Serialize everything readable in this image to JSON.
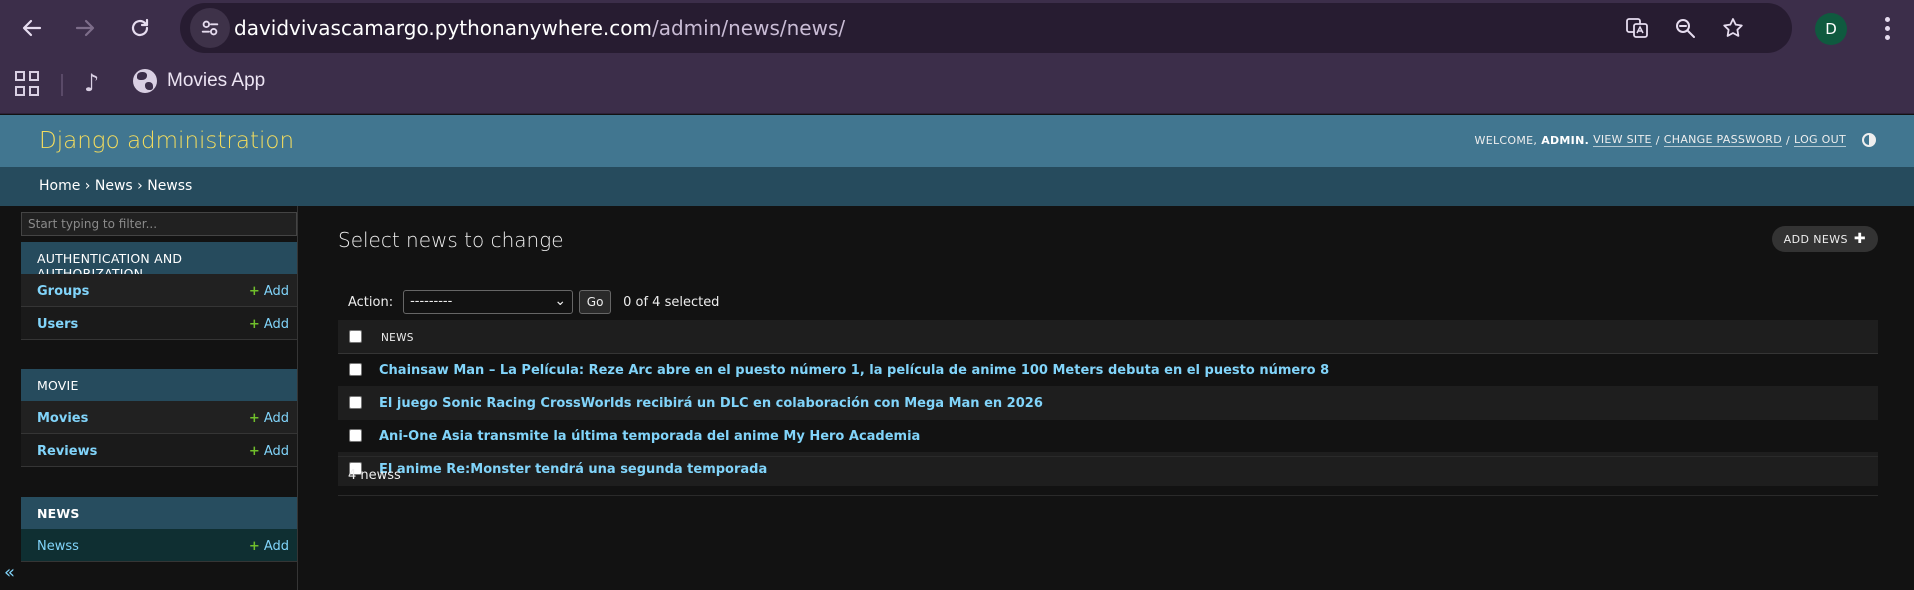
{
  "browser": {
    "url_host": "davidvivascamargo.pythonanywhere.com",
    "url_path": "/admin/news/news/",
    "profile_initial": "D",
    "bookmarks": [
      {
        "label": "Movies App"
      }
    ]
  },
  "header": {
    "branding": "Django administration",
    "welcome": "WELCOME,",
    "user": "ADMIN.",
    "view_site": "VIEW SITE",
    "change_password": "CHANGE PASSWORD",
    "log_out": "LOG OUT",
    "separator": "/"
  },
  "breadcrumbs": {
    "home": "Home",
    "app": "News",
    "model": "Newss",
    "sep": "›"
  },
  "sidebar": {
    "filter_placeholder": "Start typing to filter...",
    "collapse": "«",
    "add_label": "Add",
    "modules": [
      {
        "caption": "AUTHENTICATION AND AUTHORIZATION",
        "rows": [
          "Groups",
          "Users"
        ]
      },
      {
        "caption": "MOVIE",
        "rows": [
          "Movies",
          "Reviews"
        ]
      },
      {
        "caption": "NEWS",
        "rows": [
          "Newss"
        ]
      }
    ]
  },
  "content": {
    "title": "Select news to change",
    "add_button": "ADD NEWS",
    "action_label": "Action:",
    "action_value": "---------",
    "go_label": "Go",
    "selected_counter": "0 of 4 selected",
    "column_header": "NEWS",
    "rows": [
      "Chainsaw Man – La Película: Reze Arc abre en el puesto número 1, la película de anime 100 Meters debuta en el puesto número 8",
      "El juego Sonic Racing CrossWorlds recibirá un DLC en colaboración con Mega Man en 2026",
      "Ani-One Asia transmite la última temporada del anime My Hero Academia",
      "El anime Re:Monster tendrá una segunda temporada"
    ],
    "paginator": "4 newss"
  },
  "colors": {
    "browser_frame": "#3c2e4a",
    "django_header": "#417690",
    "branding": "#f5dd5d",
    "breadcrumbs": "#264b5d",
    "link": "#81d4fa",
    "add_plus": "#70bf2b"
  }
}
